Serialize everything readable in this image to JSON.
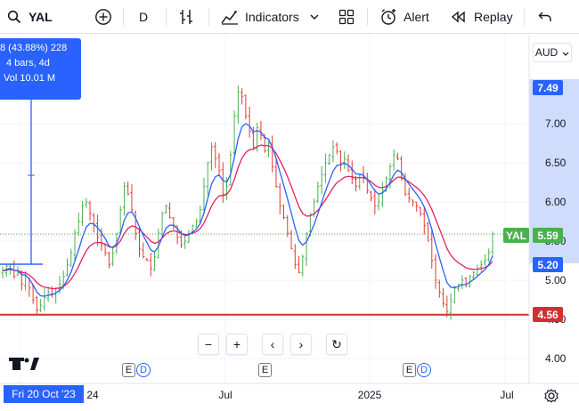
{
  "toolbar": {
    "symbol": "YAL",
    "interval": "D",
    "indicators_label": "Indicators",
    "alert_label": "Alert",
    "replay_label": "Replay"
  },
  "tooltip": {
    "line1": "8 (43.88%) 228",
    "line2": "4 bars, 4d",
    "line3": "Vol 10.01 M"
  },
  "price_axis": {
    "currency": "AUD",
    "ticks": [
      "7.00",
      "6.50",
      "6.00",
      "5.50",
      "5.00",
      "4.50",
      "4.00"
    ],
    "tag_749": "7.49",
    "tag_559": "5.59",
    "tag_520": "5.20",
    "tag_456": "4.56",
    "symbol_tag": "YAL"
  },
  "time_axis": {
    "labels": [
      "24",
      "Jul",
      "2025",
      "Jul"
    ],
    "crosshair_date": "Fri 20 Oct '23"
  },
  "events": [
    {
      "e": "E",
      "d": "D"
    },
    {
      "e": "E"
    },
    {
      "e": "E",
      "d": "D"
    }
  ],
  "nav": {
    "zoom_out": "−",
    "zoom_in": "+",
    "back": "‹",
    "forward": "›",
    "reset": "↻"
  },
  "logo": "17",
  "colors": {
    "accent": "#2962ff",
    "up": "#26a69a",
    "down": "#ef5350",
    "green_bar": "#4caf50",
    "red_bar": "#e53935",
    "ma_fast": "#2962ff",
    "ma_slow": "#e91e63",
    "support": "#d32f2f",
    "last_price": "#4caf50"
  },
  "chart_data": {
    "type": "candlestick",
    "ylim": [
      3.75,
      7.75
    ],
    "support_level": 4.56,
    "last_close": 5.59,
    "closes": [
      5.12,
      5.18,
      5.2,
      5.05,
      5.1,
      4.95,
      5.05,
      4.9,
      4.75,
      4.62,
      4.68,
      4.78,
      4.85,
      4.82,
      4.9,
      4.95,
      5.05,
      5.2,
      5.35,
      5.6,
      5.75,
      5.95,
      6.0,
      5.85,
      5.7,
      5.55,
      5.45,
      5.35,
      5.2,
      5.35,
      5.6,
      5.9,
      6.2,
      6.1,
      5.9,
      5.6,
      5.4,
      5.3,
      5.25,
      5.15,
      5.3,
      5.6,
      5.85,
      5.95,
      5.8,
      5.7,
      5.55,
      5.45,
      5.5,
      5.6,
      5.7,
      5.75,
      5.9,
      6.2,
      6.5,
      6.7,
      6.55,
      6.4,
      6.1,
      6.2,
      6.6,
      7.1,
      7.4,
      7.35,
      7.1,
      6.9,
      6.7,
      6.95,
      6.85,
      6.65,
      6.75,
      6.45,
      6.2,
      5.95,
      5.8,
      5.6,
      5.4,
      5.2,
      5.1,
      5.3,
      5.6,
      5.85,
      6.0,
      6.2,
      6.35,
      6.5,
      6.6,
      6.7,
      6.65,
      6.5,
      6.55,
      6.4,
      6.3,
      6.2,
      6.35,
      6.3,
      6.15,
      6.05,
      5.95,
      6.0,
      6.15,
      6.3,
      6.45,
      6.6,
      6.55,
      6.3,
      6.1,
      6.05,
      6.0,
      5.95,
      5.85,
      5.7,
      5.5,
      5.25,
      5.0,
      4.85,
      4.7,
      4.6,
      4.75,
      4.9,
      4.95,
      5.0,
      4.95,
      5.05,
      5.1,
      5.15,
      5.2,
      5.25,
      5.35,
      5.59
    ]
  }
}
